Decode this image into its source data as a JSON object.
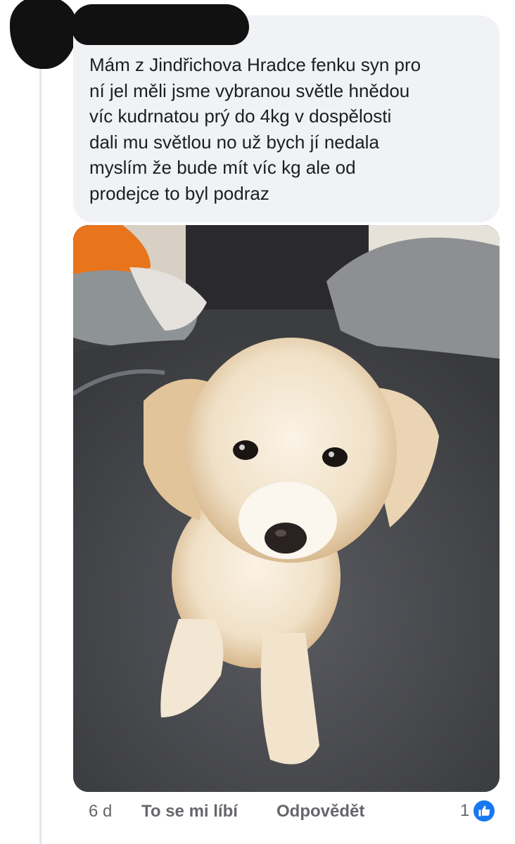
{
  "comment": {
    "text": "Mám z Jindřichova Hradce fenku syn pro\nní jel měli jsme vybranou světle hnědou\nvíc kudrnatou prý do 4kg v dospělosti\ndali mu světlou no už bych jí nedala\nmyslím že bude mít víc kg ale od\nprodejce to byl podraz",
    "time": "6 d",
    "like_label": "To se mi líbí",
    "reply_label": "Odpovědět",
    "reaction_count": "1",
    "reaction_icon": "thumbs-up-icon"
  },
  "colors": {
    "bubble": "#f0f2f5",
    "text": "#1c1e21",
    "meta": "#65676b",
    "like_blue": "#1877f2",
    "redaction": "#111111"
  }
}
